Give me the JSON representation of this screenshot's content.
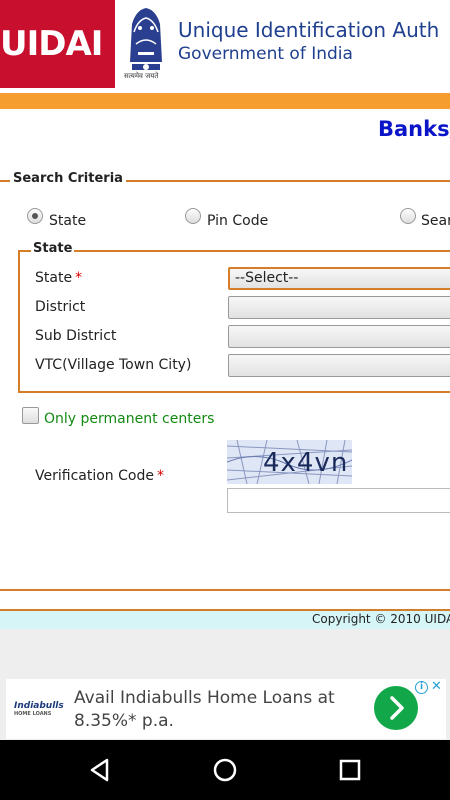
{
  "header": {
    "logo_text": "UIDAI",
    "org_name": "Unique Identification Auth",
    "gov_name": "Government of India",
    "emblem_motto": "सत्यमेव जयते"
  },
  "page_heading": "Banks/",
  "search_criteria": {
    "legend": "Search Criteria",
    "options": [
      {
        "label": "State",
        "checked": true
      },
      {
        "label": "Pin Code",
        "checked": false
      },
      {
        "label": "Sear",
        "checked": false
      }
    ]
  },
  "state_section": {
    "legend": "State",
    "fields": [
      {
        "label": "State",
        "required": "*",
        "value": "--Select--"
      },
      {
        "label": "District",
        "value": ""
      },
      {
        "label": "Sub District",
        "value": ""
      },
      {
        "label": "VTC(Village Town City)",
        "value": ""
      }
    ]
  },
  "permanent_centers_label": "Only permanent centers",
  "verification": {
    "label": "Verification Code",
    "required": "*",
    "captcha_text": "4x4vn",
    "input_value": ""
  },
  "footer": {
    "copyright": "Copyright © 2010 UIDA"
  },
  "ad": {
    "brand": "Indiabulls",
    "brand_sub": "HOME LOANS",
    "line1": "Avail Indiabulls Home Loans at",
    "line2": "8.35%* p.a.",
    "info": "i",
    "close": "✕",
    "accent_color": "#12a84a"
  },
  "navbar": {
    "icons": [
      "back-icon",
      "home-icon",
      "recents-icon"
    ]
  },
  "colors": {
    "brand_red": "#c8102e",
    "orange": "#f59d2e",
    "border_orange": "#d47e2a",
    "heading_blue": "#0a14c8",
    "green_text": "#138a13"
  }
}
